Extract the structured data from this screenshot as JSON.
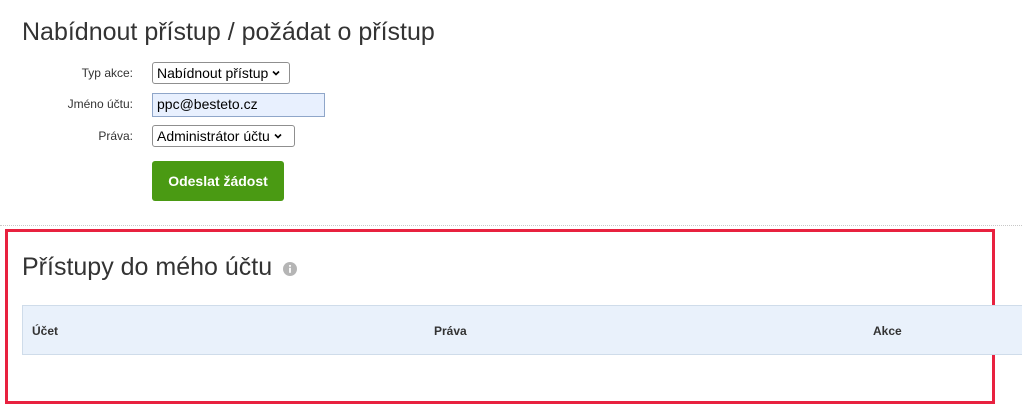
{
  "offer_section": {
    "title": "Nabídnout přístup / požádat o přístup",
    "action_type": {
      "label": "Typ akce:",
      "selected": "Nabídnout přístup"
    },
    "account_name": {
      "label": "Jméno účtu:",
      "value": "ppc@besteto.cz"
    },
    "rights": {
      "label": "Práva:",
      "selected": "Administrátor účtu"
    },
    "submit_label": "Odeslat žádost"
  },
  "access_section": {
    "title": "Přístupy do mého účtu",
    "info_icon": "info-icon",
    "highlight_color": "#e8213f",
    "table": {
      "columns": [
        "Účet",
        "Práva",
        "Akce"
      ]
    }
  },
  "colors": {
    "submit_button": "#4a9a13",
    "table_header_bg": "#e9f1fb"
  }
}
